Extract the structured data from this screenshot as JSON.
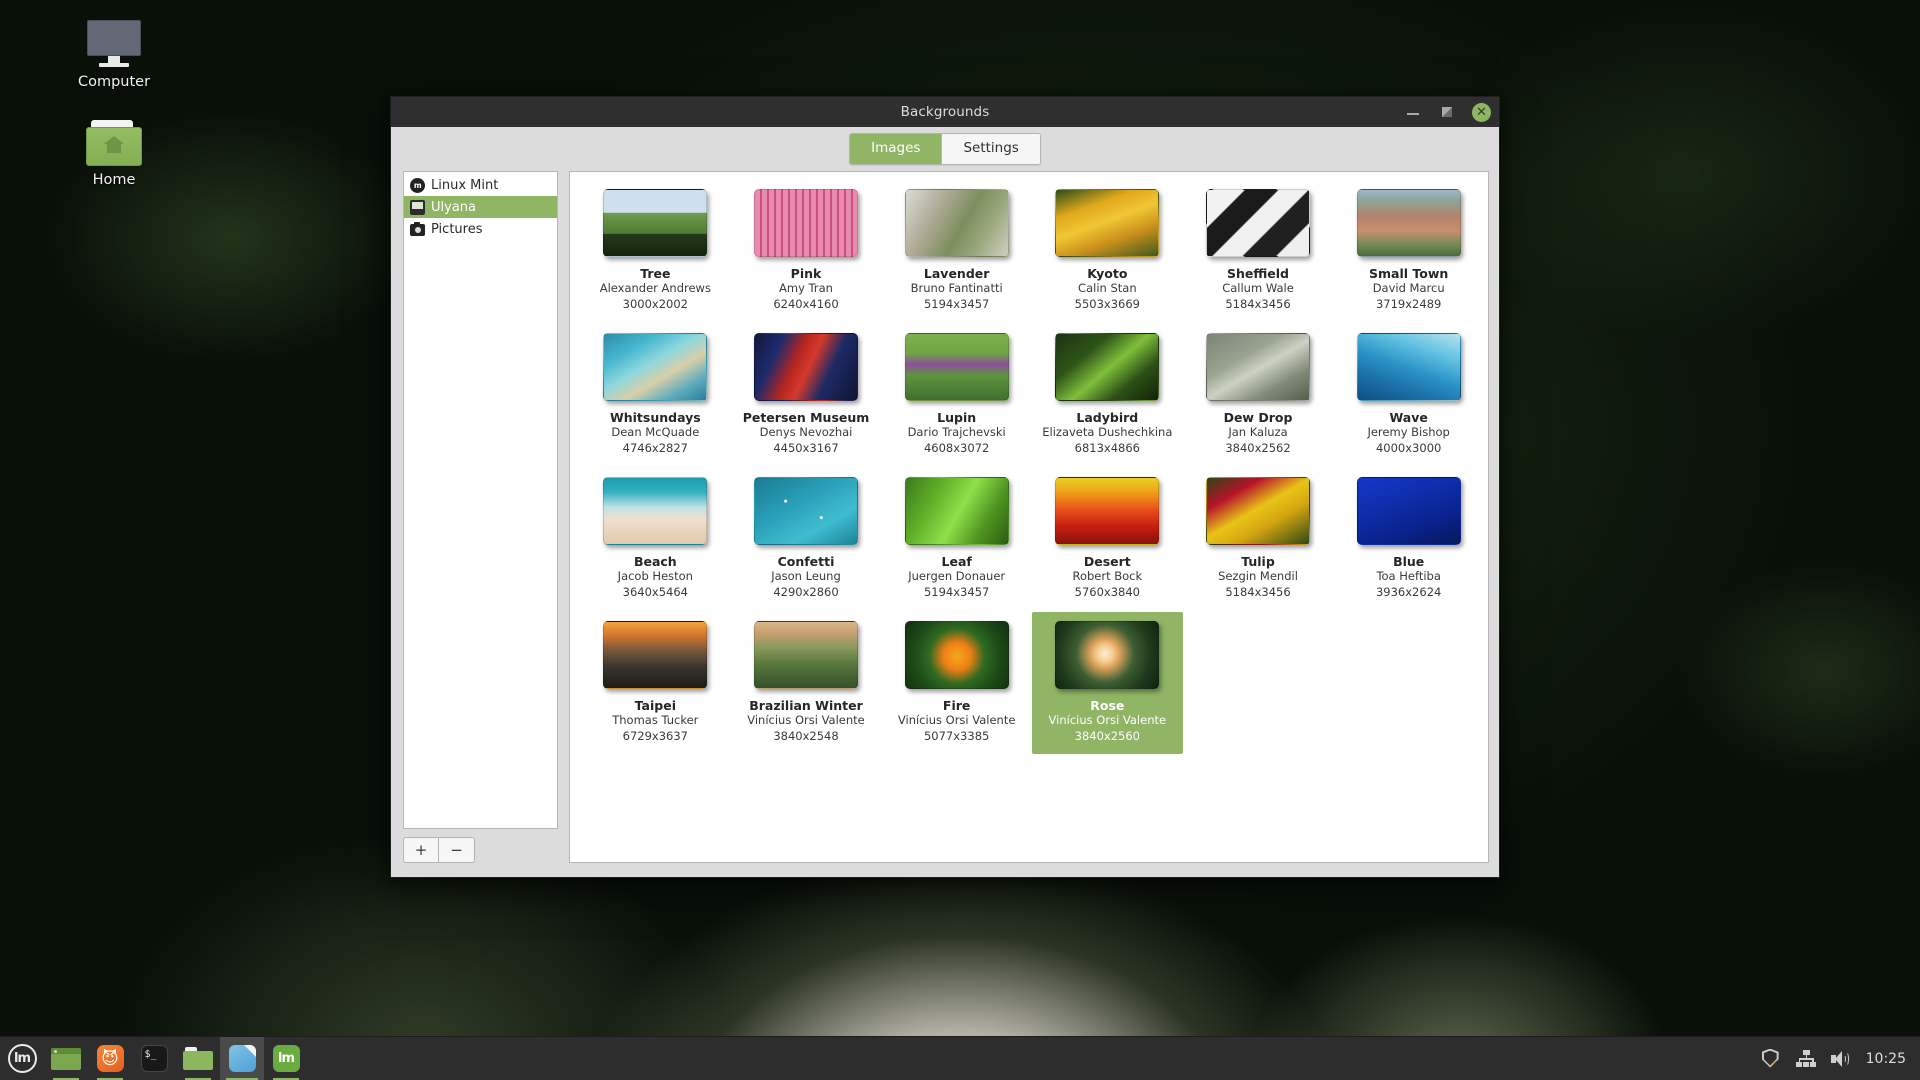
{
  "desktop": {
    "icons": [
      {
        "label": "Computer",
        "icon": "computer-icon"
      },
      {
        "label": "Home",
        "icon": "home-folder-icon"
      }
    ]
  },
  "window": {
    "title": "Backgrounds",
    "controls": {
      "minimize": "–",
      "maximize": "□",
      "close": "✕"
    },
    "tabs": [
      {
        "label": "Images",
        "active": true
      },
      {
        "label": "Settings",
        "active": false
      }
    ]
  },
  "sidebar": {
    "items": [
      {
        "label": "Linux Mint",
        "icon": "mint-logo-icon",
        "selected": false
      },
      {
        "label": "Ulyana",
        "icon": "screen-icon",
        "selected": true
      },
      {
        "label": "Pictures",
        "icon": "camera-icon",
        "selected": false
      }
    ],
    "add_label": "+",
    "remove_label": "−"
  },
  "wallpapers": [
    {
      "name": "Tree",
      "author": "Alexander Andrews",
      "dims": "3000x2002",
      "selected": false,
      "css": "linear-gradient(#cfe0ec 0%, #cfe0ec 34%, #6f9c4e 35%, #4f7a34 66%, #24381a 67%, #16240f 100%)"
    },
    {
      "name": "Pink",
      "author": "Amy Tran",
      "dims": "6240x4160",
      "selected": false,
      "css": "repeating-linear-gradient(90deg, #e98bb0 0px, #e98bb0 5px, #c8527d 5px, #c8527d 7px), linear-gradient(#eda1bf 0%, #eda1bf 48%, #cf5c87 49%, #c34e7b 100%)"
    },
    {
      "name": "Lavender",
      "author": "Bruno Fantinatti",
      "dims": "5194x3457",
      "selected": false,
      "css": "linear-gradient(120deg, #d9dcd4 0%, #b0aa96 30%, #7b8f5e 55%, #9aa87d 75%, #d0cfc2 100%)"
    },
    {
      "name": "Kyoto",
      "author": "Calin Stan",
      "dims": "5503x3669",
      "selected": false,
      "css": "linear-gradient(160deg, #2c4d18 0%, #e0a81c 28%, #f0c734 48%, #c98f1a 70%, #3f5a1e 100%)"
    },
    {
      "name": "Sheffield",
      "author": "Callum Wale",
      "dims": "5184x3456",
      "selected": false,
      "css": "linear-gradient(135deg, #f2f2f2 0%, #f2f2f2 22%, #1b1b1b 23%, #1b1b1b 42%, #f0f0f0 43%, #f0f0f0 60%, #202020 61%, #202020 80%, #efefef 81%, #efefef 100%)"
    },
    {
      "name": "Small Town",
      "author": "David Marcu",
      "dims": "3719x2489",
      "selected": false,
      "css": "linear-gradient(#9fb6c9 0%, #8ea394 18%, #b5826a 40%, #c88f6e 62%, #6f8a55 84%, #4c6b3c 100%)"
    },
    {
      "name": "Whitsundays",
      "author": "Dean McQuade",
      "dims": "4746x2827",
      "selected": false,
      "css": "linear-gradient(150deg, #2f8ba8 0%, #46b7cf 25%, #8fd8dd 45%, #d8cfa8 62%, #5aa9bd 82%, #2b7e9c 100%)"
    },
    {
      "name": "Petersen Museum",
      "author": "Denys Nevozhai",
      "dims": "4450x3167",
      "selected": false,
      "css": "linear-gradient(115deg, #14183c 0%, #1d2a6e 22%, #b4251f 40%, #d6392c 52%, #1e2a66 70%, #0f1333 100%)"
    },
    {
      "name": "Lupin",
      "author": "Dario Trajchevski",
      "dims": "4608x3072",
      "selected": false,
      "css": "linear-gradient(#7fb04c 0%, #6fa344 30%, #8b4f9e 46%, #5f9440 62%, #3f7030 100%)"
    },
    {
      "name": "Ladybird",
      "author": "Elizaveta Dushechkina",
      "dims": "6813x4866",
      "selected": false,
      "css": "linear-gradient(140deg, #1d3312 0%, #2e5418 30%, #7fbf3a 52%, #2c5016 74%, #132408 100%)"
    },
    {
      "name": "Dew Drop",
      "author": "Jan Kaluza",
      "dims": "3840x2562",
      "selected": false,
      "css": "linear-gradient(150deg, #7c8476 0%, #9aa390 35%, #cdd2c4 52%, #808a78 75%, #565f4e 100%)"
    },
    {
      "name": "Wave",
      "author": "Jeremy Bishop",
      "dims": "4000x3000",
      "selected": false,
      "css": "linear-gradient(200deg, #b8e4ef 0%, #5ec0e0 28%, #2a92c6 52%, #1b6fa8 74%, #0f4f80 100%)"
    },
    {
      "name": "Beach",
      "author": "Jacob Heston",
      "dims": "3640x5464",
      "selected": false,
      "css": "linear-gradient(#1d9ab0 0%, #35b2c2 22%, #bfe2e6 44%, #efe0cd 62%, #e2c9ad 100%)"
    },
    {
      "name": "Confetti",
      "author": "Jason Leung",
      "dims": "4290x2860",
      "selected": false,
      "css": "radial-gradient(circle at 30% 35%, #ffffff 1px, transparent 2px), radial-gradient(circle at 65% 60%, #ffffff 1px, transparent 2px), linear-gradient(150deg, #1b7a93 0%, #2aa0b8 40%, #3fbdd0 70%, #1d8399 100%)"
    },
    {
      "name": "Leaf",
      "author": "Juergen Donauer",
      "dims": "5194x3457",
      "selected": false,
      "css": "linear-gradient(120deg, #3c7a1c 0%, #62b42a 30%, #8fe04a 52%, #4d9420 76%, #2c5c14 100%)"
    },
    {
      "name": "Desert",
      "author": "Robert Bock",
      "dims": "5760x3840",
      "selected": false,
      "css": "linear-gradient(#e8d026 0%, #f0a018 22%, #e8511a 48%, #c91f12 72%, #8a1208 100%)"
    },
    {
      "name": "Tulip",
      "author": "Sezgin Mendil",
      "dims": "5184x3456",
      "selected": false,
      "css": "linear-gradient(150deg, #2e4416 0%, #b5132a 25%, #e9c417 48%, #d4a40f 66%, #2d4a16 100%)"
    },
    {
      "name": "Blue",
      "author": "Toa Heftiba",
      "dims": "3936x2624",
      "selected": false,
      "css": "linear-gradient(160deg, #1437c6 0%, #0f2fae 35%, #0a2390 65%, #06195f 100%)"
    },
    {
      "name": "Taipei",
      "author": "Thomas Tucker",
      "dims": "6729x3637",
      "selected": false,
      "css": "linear-gradient(#f0a63c 0%, #d4762c 20%, #7a5a3c 42%, #3c3830 66%, #1e1c18 100%)"
    },
    {
      "name": "Brazilian Winter",
      "author": "Vinícius Orsi Valente",
      "dims": "3840x2548",
      "selected": false,
      "css": "linear-gradient(#d9b98c 0%, #c8a070 16%, #8a9a5c 38%, #5d7a3e 62%, #33522a 100%)"
    },
    {
      "name": "Fire",
      "author": "Vinícius Orsi Valente",
      "dims": "5077x3385",
      "selected": false,
      "css": "radial-gradient(circle at 50% 52%, #f7a81c 0%, #ef7f14 22%, #2f6a22 45%, #1d4a18 70%, #12300f 100%)"
    },
    {
      "name": "Rose",
      "author": "Vinícius Orsi Valente",
      "dims": "3840x2560",
      "selected": true,
      "css": "radial-gradient(circle at 48% 48%, #fdf0dc 0%, #f3c98a 14%, #e2a45e 22%, #3d5e33 46%, #1e3a1c 72%, #102210 100%)"
    }
  ],
  "taskbar": {
    "menu_label": "lm",
    "items": [
      {
        "name": "window-list-item",
        "icon": "window-icon",
        "state": "running"
      },
      {
        "name": "firefox-item",
        "icon": "firefox-icon",
        "state": "running"
      },
      {
        "name": "terminal-item",
        "icon": "terminal-icon",
        "state": "idle"
      },
      {
        "name": "files-item",
        "icon": "folder-icon",
        "state": "running"
      },
      {
        "name": "backgrounds-item",
        "icon": "document-icon",
        "state": "active"
      },
      {
        "name": "mint-app-item",
        "icon": "mint-app-icon",
        "state": "running"
      }
    ],
    "tray": [
      {
        "name": "update-shield-icon"
      },
      {
        "name": "network-icon"
      },
      {
        "name": "volume-icon"
      }
    ],
    "clock": "10:25"
  },
  "colors": {
    "accent": "#8fb565",
    "titlebar": "#2f2f2f",
    "panel": "#dcdcdc",
    "taskbar": "#2d2d2d"
  }
}
